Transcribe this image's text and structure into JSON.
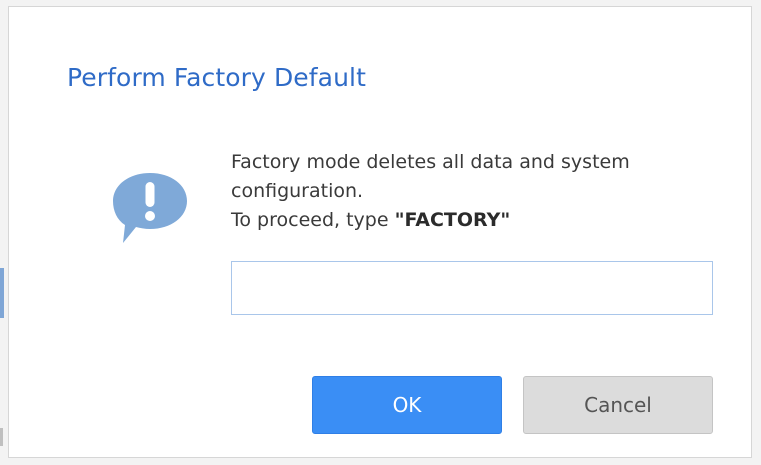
{
  "dialog": {
    "title": "Perform Factory Default",
    "message_line1": "Factory mode deletes all data and system",
    "message_line2": "configuration.",
    "message_line3_prefix": "To proceed, type ",
    "message_line3_keyword": "\"FACTORY\"",
    "input": {
      "value": "",
      "placeholder": ""
    },
    "ok_label": "OK",
    "cancel_label": "Cancel",
    "icon": "exclamation-speech-bubble-icon"
  },
  "colors": {
    "title": "#2f6bc7",
    "icon": "#7fa9d8",
    "ok_button": "#3a8ef5",
    "cancel_button": "#dcdcdc",
    "input_border": "#a9c6ea"
  }
}
